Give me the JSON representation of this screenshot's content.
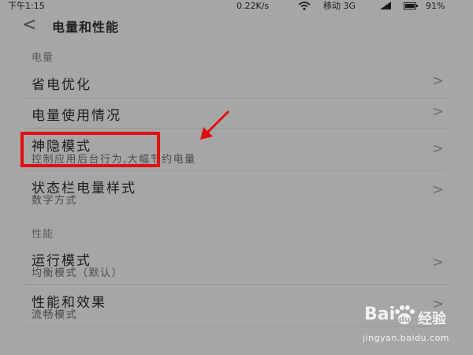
{
  "status_bar": {
    "time": "下午1:15",
    "network_speed": "0.22K/s",
    "carrier": "移动 3G",
    "battery": "91%"
  },
  "header": {
    "back_icon": "back-chevron-icon",
    "title": "电量和性能"
  },
  "sections": {
    "battery": {
      "header": "电量",
      "items": [
        {
          "title": "省电优化"
        },
        {
          "title": "电量使用情况"
        },
        {
          "title": "神隐模式",
          "subtitle": "控制应用后台行为,大幅节约电量"
        },
        {
          "title": "状态栏电量样式",
          "subtitle": "数字方式"
        }
      ]
    },
    "performance": {
      "header": "性能",
      "items": [
        {
          "title": "运行模式",
          "subtitle": "均衡模式（默认）"
        },
        {
          "title": "性能和效果",
          "subtitle": "流畅模式"
        }
      ]
    }
  },
  "chevron_glyph": ">",
  "annotation": {
    "highlight_color": "#e01010"
  },
  "watermark": {
    "logo": "Bai",
    "logo_suffix": "经验",
    "url": "jingyan.baidu.com"
  }
}
